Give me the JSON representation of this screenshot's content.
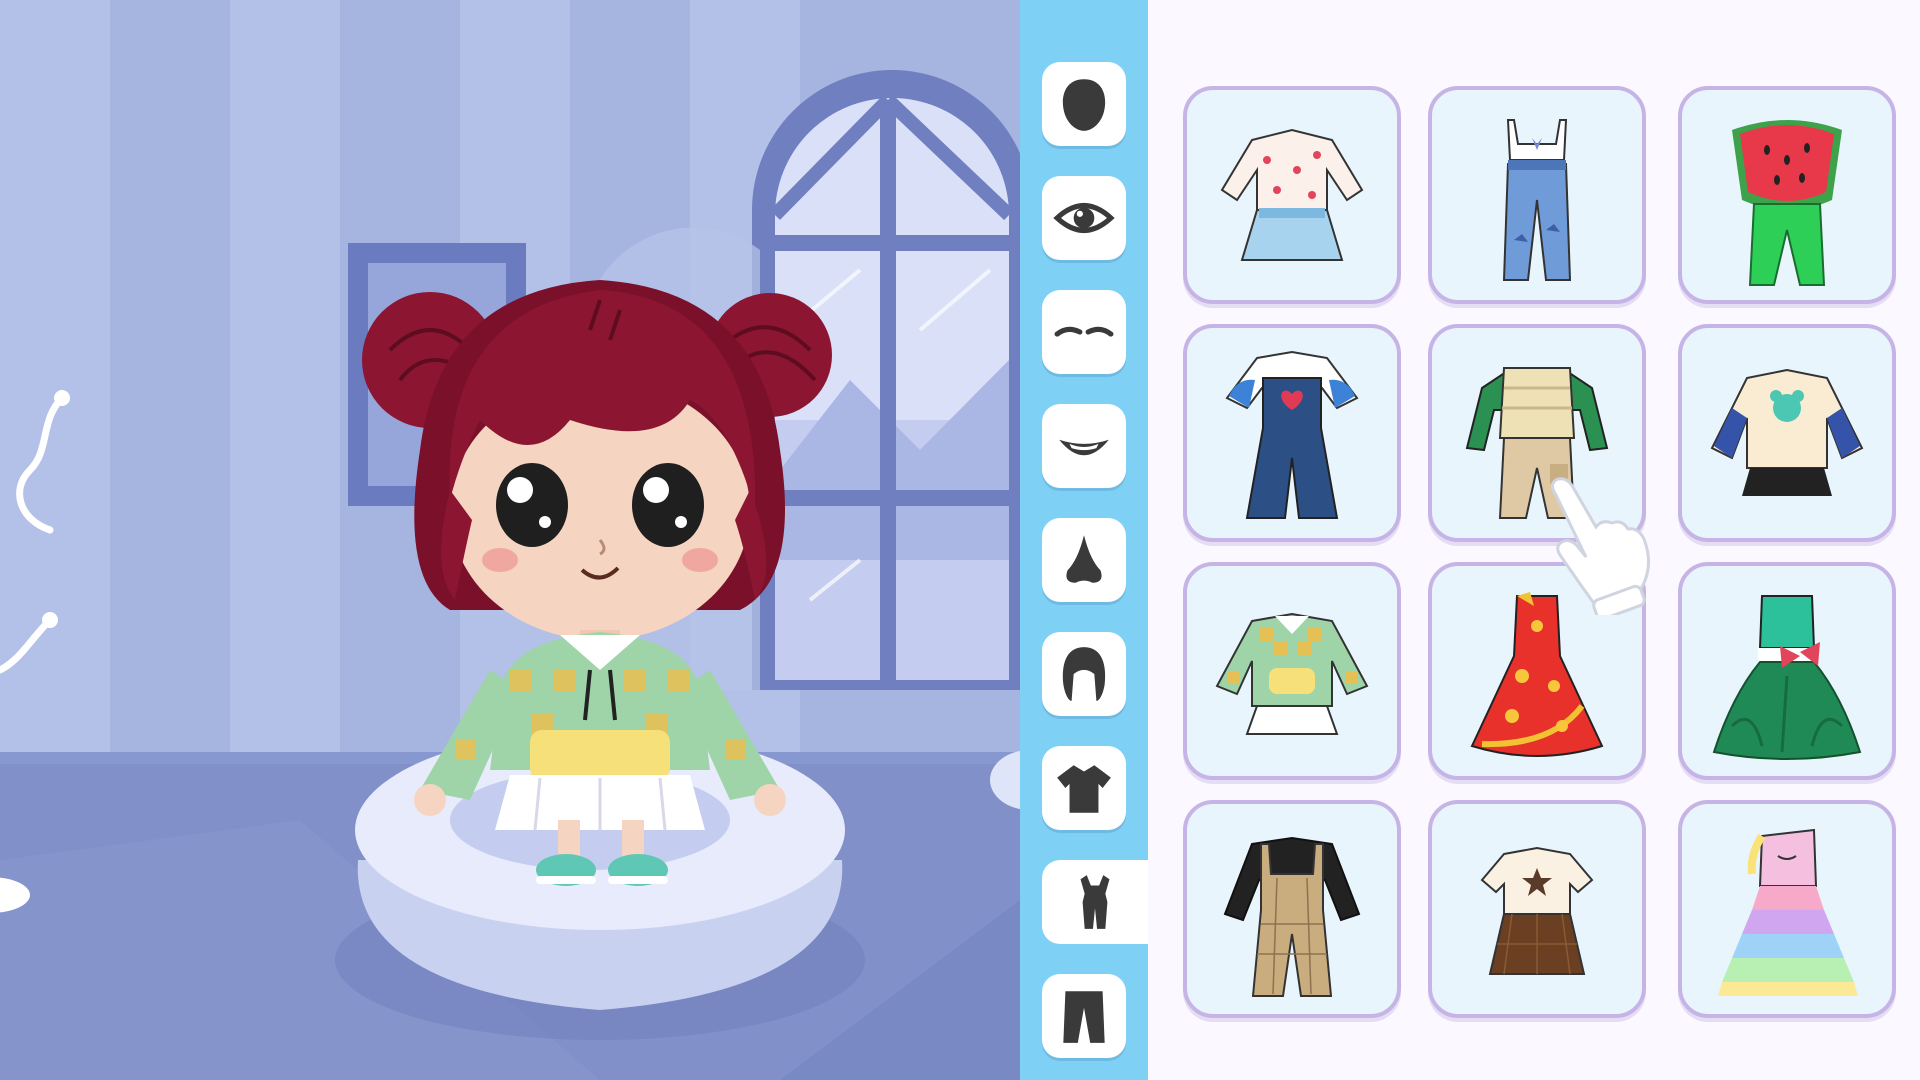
{
  "game": {
    "screen": "dress-up",
    "character": {
      "hair_color": "#8c1631",
      "skin_color": "#f6d4c2",
      "outfit": "checkered-hoodie-with-skirt"
    }
  },
  "sidebar": {
    "categories": [
      {
        "icon": "face-shape-icon"
      },
      {
        "icon": "eye-icon"
      },
      {
        "icon": "eyebrow-icon"
      },
      {
        "icon": "mouth-icon"
      },
      {
        "icon": "nose-icon"
      },
      {
        "icon": "hair-icon"
      },
      {
        "icon": "shirt-icon"
      },
      {
        "icon": "full-outfit-icon",
        "selected": true
      },
      {
        "icon": "pants-icon"
      }
    ]
  },
  "outfits": [
    {
      "name": "cherry-top-denim-skirt"
    },
    {
      "name": "butterfly-tank-jeans"
    },
    {
      "name": "watermelon-costume"
    },
    {
      "name": "heart-overalls"
    },
    {
      "name": "puffer-vest-cargo"
    },
    {
      "name": "bear-sweater-skirt"
    },
    {
      "name": "checkered-hoodie-skirt"
    },
    {
      "name": "red-floral-gown"
    },
    {
      "name": "green-bow-gown"
    },
    {
      "name": "plaid-overalls"
    },
    {
      "name": "star-tee-brown-skirt"
    },
    {
      "name": "rainbow-unicorn-dress"
    }
  ],
  "colors": {
    "sidebar": "#7fd0f5",
    "panel": "#fbf9ff",
    "card": "#e9f5fd",
    "card_border": "#c7b4e6",
    "room_wall": "#a9b7e2"
  }
}
